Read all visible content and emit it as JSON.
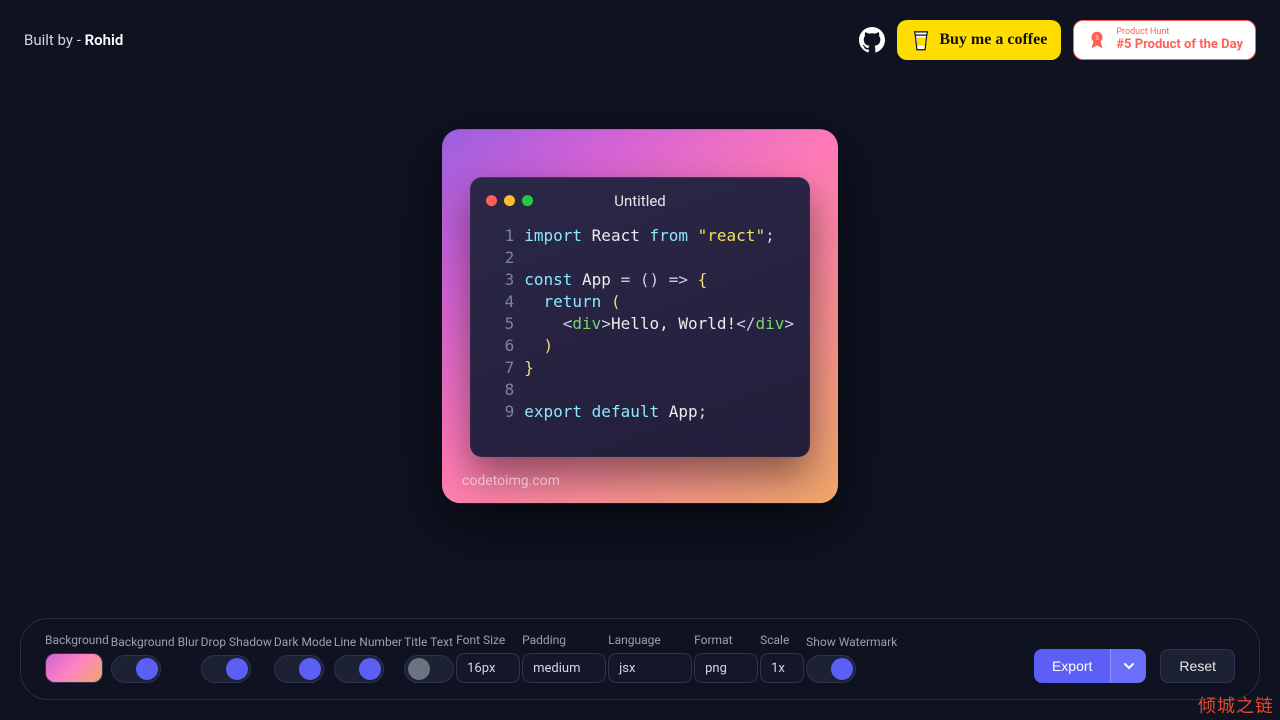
{
  "header": {
    "built_by_prefix": "Built by - ",
    "built_by_name": "Rohid",
    "bmc_label": "Buy me a coffee",
    "ph_sub": "Product Hunt",
    "ph_main": "#5 Product of the Day"
  },
  "editor": {
    "title": "Untitled",
    "watermark": "codetoimg.com",
    "line_numbers": [
      "1",
      "2",
      "3",
      "4",
      "5",
      "6",
      "7",
      "8",
      "9"
    ],
    "code_lines": [
      [
        {
          "t": "import ",
          "c": "tok-kw"
        },
        {
          "t": "React ",
          "c": "tok-id"
        },
        {
          "t": "from ",
          "c": "tok-kw"
        },
        {
          "t": "\"react\"",
          "c": "tok-str"
        },
        {
          "t": ";",
          "c": "tok-op"
        }
      ],
      [],
      [
        {
          "t": "const ",
          "c": "tok-kw"
        },
        {
          "t": "App ",
          "c": "tok-id"
        },
        {
          "t": "= ",
          "c": "tok-op"
        },
        {
          "t": "() ",
          "c": "tok-op"
        },
        {
          "t": "=> ",
          "c": "tok-op"
        },
        {
          "t": "{",
          "c": "tok-brace"
        }
      ],
      [
        {
          "t": "  return ",
          "c": "tok-kw"
        },
        {
          "t": "(",
          "c": "tok-brace"
        }
      ],
      [
        {
          "t": "    <",
          "c": "tok-op"
        },
        {
          "t": "div",
          "c": "tok-tag"
        },
        {
          "t": ">",
          "c": "tok-op"
        },
        {
          "t": "Hello, World!",
          "c": "tok-text"
        },
        {
          "t": "</",
          "c": "tok-op"
        },
        {
          "t": "div",
          "c": "tok-tag"
        },
        {
          "t": ">",
          "c": "tok-op"
        }
      ],
      [
        {
          "t": "  )",
          "c": "tok-brace"
        }
      ],
      [
        {
          "t": "}",
          "c": "tok-brace"
        }
      ],
      [],
      [
        {
          "t": "export ",
          "c": "tok-kw"
        },
        {
          "t": "default ",
          "c": "tok-kw"
        },
        {
          "t": "App",
          "c": "tok-id"
        },
        {
          "t": ";",
          "c": "tok-op"
        }
      ]
    ]
  },
  "toolbar": {
    "background_label": "Background",
    "background_blur_label": "Background Blur",
    "drop_shadow_label": "Drop Shadow",
    "dark_mode_label": "Dark Mode",
    "line_number_label": "Line Number",
    "title_text_label": "Title Text",
    "font_size_label": "Font Size",
    "font_size_value": "16px",
    "padding_label": "Padding",
    "padding_value": "medium",
    "language_label": "Language",
    "language_value": "jsx",
    "format_label": "Format",
    "format_value": "png",
    "scale_label": "Scale",
    "scale_value": "1x",
    "show_watermark_label": "Show Watermark",
    "export_label": "Export",
    "reset_label": "Reset",
    "toggles": {
      "background_blur": true,
      "drop_shadow": true,
      "dark_mode": true,
      "line_number": true,
      "title_text": false,
      "show_watermark": true
    }
  },
  "corner_brand": "倾城之链"
}
